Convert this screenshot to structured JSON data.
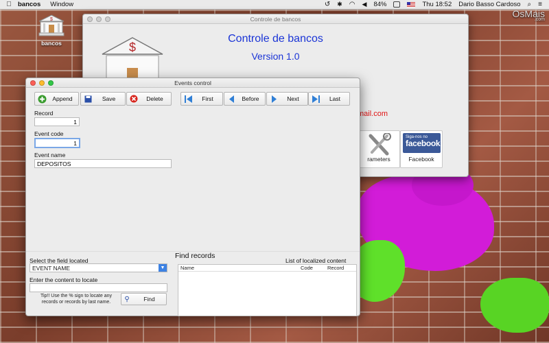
{
  "menubar": {
    "app_name": "bancos",
    "menu_window": "Window",
    "battery": "84%",
    "clock": "Thu 18:52",
    "user": "Dario Basso Cardoso"
  },
  "desktop": {
    "icon_label": "bancos",
    "brand": "OsMais",
    "brand_sub": ".com"
  },
  "main_window": {
    "title": "Controle de bancos",
    "app_title": "Controle de bancos",
    "version": "Version 1.0",
    "email_fragment": "mail.com",
    "tile_params_label": "rameters",
    "tile_facebook_label": "Facebook",
    "fb_small": "Siga-nos no",
    "fb_big": "facebook"
  },
  "events_window": {
    "title": "Events control",
    "toolbar": {
      "append": "Append",
      "save": "Save",
      "delete": "Delete",
      "first": "First",
      "before": "Before",
      "next": "Next",
      "last": "Last"
    },
    "form": {
      "record_label": "Record",
      "record_value": "1",
      "event_code_label": "Event code",
      "event_code_value": "1",
      "event_name_label": "Event name",
      "event_name_value": "DEPOSITOS"
    },
    "search": {
      "field_label": "Select the field located",
      "field_value": "EVENT NAME",
      "content_label": "Enter the content to locate",
      "content_value": "",
      "tip": "Tip!! Use the % sign to locate any records or records by last name.",
      "find_button": "Find"
    },
    "results": {
      "find_title": "Find records",
      "list_title": "List of localized content",
      "columns": [
        "Name",
        "Code",
        "Record"
      ]
    }
  },
  "colors": {
    "accent_blue": "#1a34d6",
    "email_red": "#e01212",
    "facebook": "#3b5998"
  }
}
